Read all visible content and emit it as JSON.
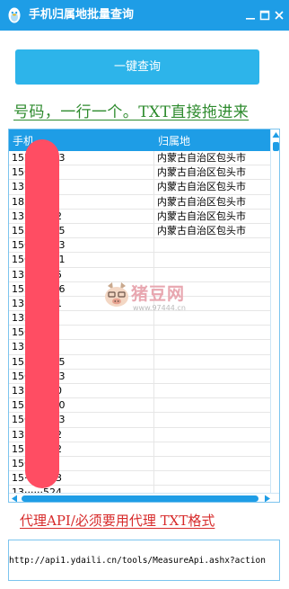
{
  "window": {
    "title": "手机归属地批量查询"
  },
  "toolbar": {
    "query_button": "一键查询"
  },
  "hints": {
    "top": "号码，一行一个。TXT直接拖进来",
    "bottom": "代理API/必须要用代理 TXT格式"
  },
  "grid": {
    "columns": [
      "手机",
      "归属地"
    ],
    "rows": [
      [
        "155·····003",
        "内蒙古自治区包头市"
      ],
      [
        "156·····38",
        "内蒙古自治区包头市"
      ],
      [
        "13······60",
        "内蒙古自治区包头市"
      ],
      [
        "185·····73",
        "内蒙古自治区包头市"
      ],
      [
        "13······732",
        "内蒙古自治区包头市"
      ],
      [
        "155·····075",
        "内蒙古自治区包头市"
      ],
      [
        "156·····293",
        ""
      ],
      [
        "156·····001",
        ""
      ],
      [
        "13······105",
        ""
      ],
      [
        "155·····316",
        ""
      ],
      [
        "13······241",
        ""
      ],
      [
        "132·····38",
        ""
      ],
      [
        "156·····42",
        ""
      ],
      [
        "13······78",
        ""
      ],
      [
        "155·····925",
        ""
      ],
      [
        "156·····563",
        ""
      ],
      [
        "13······720",
        ""
      ],
      [
        "155·····240",
        ""
      ],
      [
        "156·····013",
        ""
      ],
      [
        "13······572",
        ""
      ],
      [
        "15······952",
        ""
      ],
      [
        "156·····30",
        ""
      ],
      [
        "15······083",
        ""
      ],
      [
        "13······524",
        ""
      ],
      [
        "155·····004",
        ""
      ]
    ]
  },
  "watermark": {
    "name": "猪豆网",
    "url": "www.97444.cn"
  },
  "proxy": {
    "api_url": "http://api1.ydaili.cn/tools/MeasureApi.ashx?action"
  },
  "colors": {
    "titlebar": "#1e9de6",
    "button": "#2db4ea",
    "hint_top": "#2e8b2e",
    "hint_bottom": "#d72b2b",
    "redaction": "#ff4d63"
  },
  "icons": [
    "qq-penguin-icon",
    "minimize-icon",
    "maximize-icon",
    "close-icon",
    "scroll-up-arrow-icon",
    "scroll-left-arrow-icon",
    "scroll-right-arrow-icon",
    "pig-logo-icon"
  ]
}
